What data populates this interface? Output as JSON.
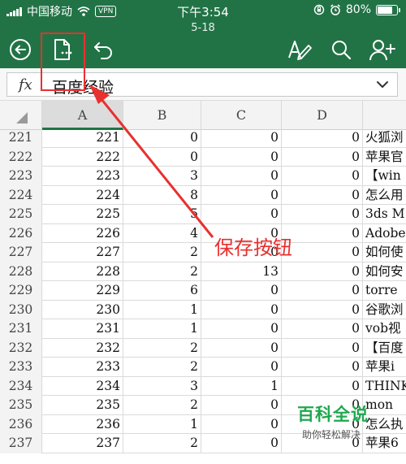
{
  "status_bar": {
    "carrier": "中国移动",
    "vpn": "VPN",
    "time": "下午3:54",
    "battery": "80%",
    "battery_level": 0.8
  },
  "toolbar": {
    "document_title": "5-18",
    "icons": [
      "back-icon",
      "save-icon",
      "undo-icon",
      "format-pen-icon",
      "search-icon",
      "share-person-icon"
    ]
  },
  "formula_bar": {
    "fx_label": "fx",
    "value": "百度经验"
  },
  "sheet": {
    "columns": [
      "A",
      "B",
      "C",
      "D"
    ],
    "selected_column": "A",
    "rows": [
      {
        "num": "221",
        "a": "221",
        "b": "0",
        "c": "0",
        "d": "0",
        "e": "火狐浏"
      },
      {
        "num": "222",
        "a": "222",
        "b": "0",
        "c": "0",
        "d": "0",
        "e": "苹果官"
      },
      {
        "num": "223",
        "a": "223",
        "b": "3",
        "c": "0",
        "d": "0",
        "e": "【win"
      },
      {
        "num": "224",
        "a": "224",
        "b": "8",
        "c": "0",
        "d": "0",
        "e": "怎么用"
      },
      {
        "num": "225",
        "a": "225",
        "b": "5",
        "c": "0",
        "d": "0",
        "e": "3ds M"
      },
      {
        "num": "226",
        "a": "226",
        "b": "4",
        "c": "0",
        "d": "0",
        "e": "Adobe"
      },
      {
        "num": "227",
        "a": "227",
        "b": "2",
        "c": "0",
        "d": "0",
        "e": "如何使"
      },
      {
        "num": "228",
        "a": "228",
        "b": "2",
        "c": "13",
        "d": "0",
        "e": "如何安"
      },
      {
        "num": "229",
        "a": "229",
        "b": "6",
        "c": "0",
        "d": "0",
        "e": "torre"
      },
      {
        "num": "230",
        "a": "230",
        "b": "1",
        "c": "0",
        "d": "0",
        "e": "谷歌浏"
      },
      {
        "num": "231",
        "a": "231",
        "b": "1",
        "c": "0",
        "d": "0",
        "e": "vob视"
      },
      {
        "num": "232",
        "a": "232",
        "b": "2",
        "c": "0",
        "d": "0",
        "e": "【百度"
      },
      {
        "num": "233",
        "a": "233",
        "b": "2",
        "c": "0",
        "d": "0",
        "e": "苹果i"
      },
      {
        "num": "234",
        "a": "234",
        "b": "3",
        "c": "1",
        "d": "0",
        "e": "THINK"
      },
      {
        "num": "235",
        "a": "235",
        "b": "2",
        "c": "0",
        "d": "0",
        "e": "mon"
      },
      {
        "num": "236",
        "a": "236",
        "b": "1",
        "c": "0",
        "d": "0",
        "e": "怎么执"
      },
      {
        "num": "237",
        "a": "237",
        "b": "2",
        "c": "0",
        "d": "0",
        "e": "苹果6"
      }
    ]
  },
  "annotation": {
    "label": "保存按钮",
    "color": "#e8302f"
  },
  "watermark": {
    "title": "百科全说",
    "subtitle": "助你轻松解决"
  },
  "colors": {
    "header_green": "#217346"
  }
}
